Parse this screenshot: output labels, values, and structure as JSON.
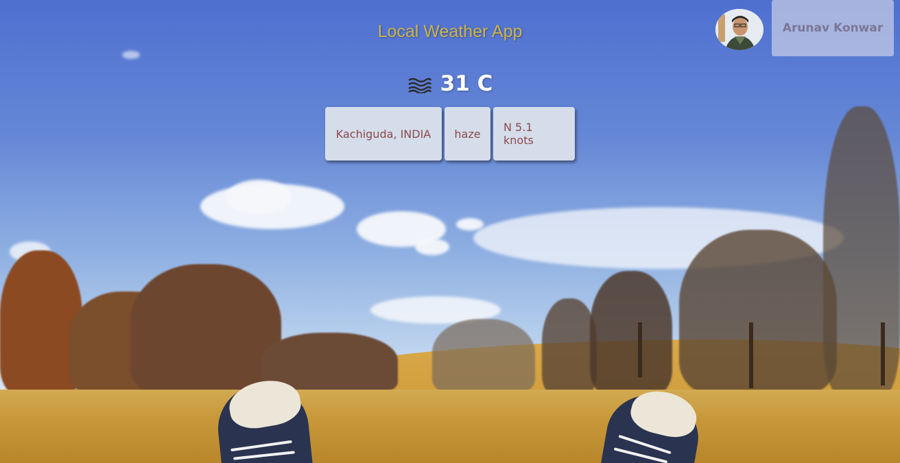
{
  "app": {
    "title": "Local Weather App"
  },
  "weather": {
    "temperature": "31 C",
    "icon": "haze-icon",
    "location": "Kachiguda, INDIA",
    "condition": "haze",
    "wind": "N 5.1 knots"
  },
  "user": {
    "name": "Arunav Konwar",
    "avatar_icon": "avatar-photo"
  },
  "colors": {
    "title": "#cdb54a",
    "info_box_bg": "#d5dcea",
    "info_text": "#8a4a4a",
    "user_text": "#7a7796"
  }
}
